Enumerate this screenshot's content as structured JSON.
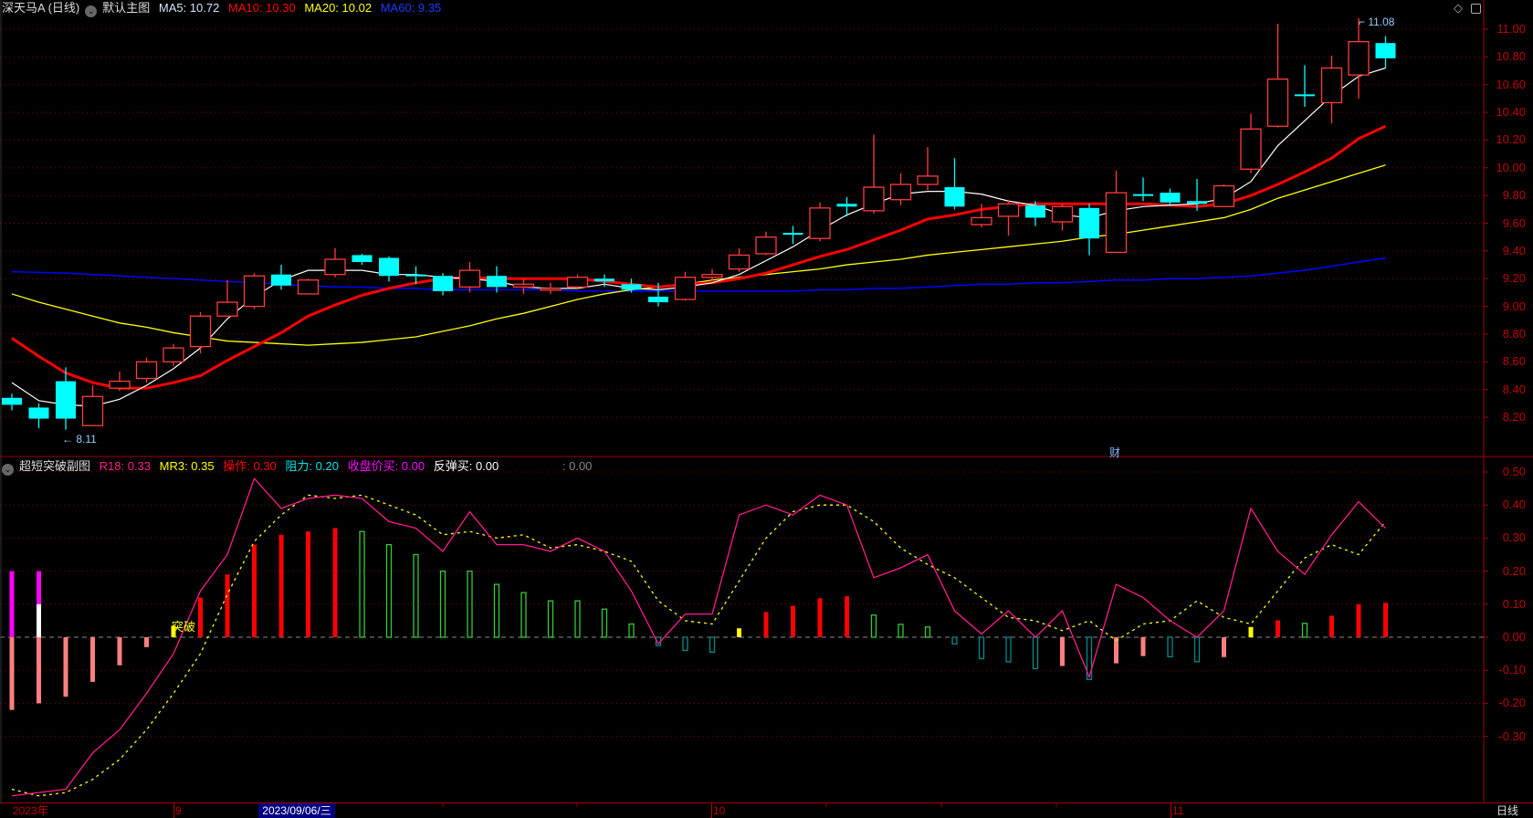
{
  "main_header": {
    "symbol": "深天马A (日线)",
    "template": "默认主图",
    "ma5": "MA5: 10.72",
    "ma10": "MA10: 10.30",
    "ma20": "MA20: 10.02",
    "ma60": "MA60: 9.35"
  },
  "sub_header": {
    "name": "超短突破副图",
    "r18": "R18: 0.33",
    "mr3": "MR3: 0.35",
    "op": "操作: 0.30",
    "res": "阻力: 0.20",
    "close_buy": "收盘价买: 0.00",
    "rebound_buy": "反弹买: 0.00",
    "blank": ": 0.00"
  },
  "colors": {
    "up": "#ff3b3b",
    "down": "#00ffff",
    "ma5": "#ffffff",
    "ma10": "#ff0000",
    "ma20": "#ffff00",
    "ma60": "#0000ff",
    "r18": "#ff1a8c",
    "mr3": "#ffff00",
    "axis": "#c00000"
  },
  "price_axis": [
    "11.00",
    "10.80",
    "10.60",
    "10.40",
    "10.20",
    "10.00",
    "9.80",
    "9.60",
    "9.40",
    "9.20",
    "9.00",
    "8.80",
    "8.60",
    "8.40",
    "8.20"
  ],
  "sub_axis": [
    "0.50",
    "0.40",
    "0.30",
    "0.20",
    "0.10",
    "0.00",
    "-0.10",
    "-0.20",
    "-0.30"
  ],
  "low_marker": "8.11",
  "high_marker": "11.08",
  "finance_marker": "财",
  "signal_label": "突破",
  "dates": {
    "year": "2023年",
    "m9": "9",
    "selected": "2023/09/06/三",
    "m10": "10",
    "m11": "11",
    "period": "日线"
  },
  "icons": {
    "diamond": "diamond-icon",
    "panel": "panel-toggle-icon",
    "collapse": "chevron-down-icon"
  },
  "ohlc": [
    [
      8.34,
      8.37,
      8.25,
      8.29
    ],
    [
      8.27,
      8.3,
      8.12,
      8.19
    ],
    [
      8.46,
      8.56,
      8.11,
      8.19
    ],
    [
      8.14,
      8.43,
      8.14,
      8.35
    ],
    [
      8.41,
      8.53,
      8.39,
      8.46
    ],
    [
      8.48,
      8.63,
      8.45,
      8.6
    ],
    [
      8.6,
      8.73,
      8.57,
      8.7
    ],
    [
      8.71,
      8.96,
      8.66,
      8.93
    ],
    [
      8.93,
      9.19,
      8.93,
      9.03
    ],
    [
      9.0,
      9.24,
      8.98,
      9.22
    ],
    [
      9.23,
      9.3,
      9.12,
      9.15
    ],
    [
      9.09,
      9.2,
      9.09,
      9.19
    ],
    [
      9.23,
      9.42,
      9.21,
      9.34
    ],
    [
      9.37,
      9.38,
      9.3,
      9.32
    ],
    [
      9.35,
      9.36,
      9.18,
      9.22
    ],
    [
      9.23,
      9.29,
      9.16,
      9.22
    ],
    [
      9.22,
      9.24,
      9.08,
      9.11
    ],
    [
      9.14,
      9.32,
      9.1,
      9.26
    ],
    [
      9.22,
      9.29,
      9.1,
      9.14
    ],
    [
      9.14,
      9.2,
      9.09,
      9.16
    ],
    [
      9.12,
      9.17,
      9.09,
      9.13
    ],
    [
      9.14,
      9.23,
      9.12,
      9.21
    ],
    [
      9.2,
      9.23,
      9.14,
      9.18
    ],
    [
      9.16,
      9.2,
      9.1,
      9.12
    ],
    [
      9.07,
      9.17,
      9.0,
      9.03
    ],
    [
      9.05,
      9.25,
      9.04,
      9.21
    ],
    [
      9.21,
      9.27,
      9.19,
      9.23
    ],
    [
      9.27,
      9.42,
      9.25,
      9.37
    ],
    [
      9.38,
      9.54,
      9.37,
      9.5
    ],
    [
      9.53,
      9.58,
      9.45,
      9.52
    ],
    [
      9.49,
      9.75,
      9.47,
      9.71
    ],
    [
      9.74,
      9.79,
      9.65,
      9.72
    ],
    [
      9.69,
      10.24,
      9.67,
      9.86
    ],
    [
      9.77,
      9.96,
      9.73,
      9.88
    ],
    [
      9.88,
      10.15,
      9.84,
      9.94
    ],
    [
      9.86,
      10.07,
      9.7,
      9.72
    ],
    [
      9.59,
      9.74,
      9.57,
      9.64
    ],
    [
      9.65,
      9.77,
      9.51,
      9.74
    ],
    [
      9.73,
      9.76,
      9.58,
      9.64
    ],
    [
      9.61,
      9.74,
      9.55,
      9.72
    ],
    [
      9.71,
      9.74,
      9.37,
      9.49
    ],
    [
      9.39,
      9.98,
      9.39,
      9.82
    ],
    [
      9.81,
      9.93,
      9.76,
      9.8
    ],
    [
      9.82,
      9.85,
      9.73,
      9.75
    ],
    [
      9.76,
      9.92,
      9.69,
      9.74
    ],
    [
      9.72,
      9.88,
      9.72,
      9.87
    ],
    [
      9.99,
      10.39,
      9.96,
      10.28
    ],
    [
      10.3,
      11.04,
      10.29,
      10.64
    ],
    [
      10.53,
      10.74,
      10.44,
      10.52
    ],
    [
      10.47,
      10.81,
      10.32,
      10.72
    ],
    [
      10.67,
      11.08,
      10.5,
      10.91
    ],
    [
      10.9,
      10.95,
      10.72,
      10.79
    ]
  ],
  "ma5": [
    8.45,
    8.32,
    8.29,
    8.28,
    8.33,
    8.43,
    8.55,
    8.7,
    8.91,
    9.07,
    9.19,
    9.26,
    9.26,
    9.26,
    9.23,
    9.23,
    9.21,
    9.2,
    9.18,
    9.14,
    9.13,
    9.13,
    9.16,
    9.13,
    9.12,
    9.14,
    9.17,
    9.23,
    9.33,
    9.43,
    9.55,
    9.66,
    9.74,
    9.81,
    9.83,
    9.83,
    9.81,
    9.76,
    9.73,
    9.66,
    9.64,
    9.69,
    9.72,
    9.73,
    9.74,
    9.78,
    9.9,
    10.16,
    10.34,
    10.52,
    10.66,
    10.72
  ],
  "ma10": [
    8.77,
    8.64,
    8.52,
    8.45,
    8.41,
    8.41,
    8.45,
    8.5,
    8.61,
    8.71,
    8.81,
    8.93,
    9.01,
    9.08,
    9.13,
    9.17,
    9.2,
    9.21,
    9.2,
    9.2,
    9.2,
    9.2,
    9.18,
    9.16,
    9.14,
    9.16,
    9.17,
    9.2,
    9.24,
    9.3,
    9.36,
    9.41,
    9.48,
    9.55,
    9.63,
    9.66,
    9.7,
    9.72,
    9.74,
    9.74,
    9.74,
    9.74,
    9.74,
    9.73,
    9.72,
    9.74,
    9.8,
    9.88,
    9.97,
    10.07,
    10.21,
    10.3
  ],
  "ma20": [
    9.09,
    9.03,
    8.98,
    8.93,
    8.88,
    8.85,
    8.81,
    8.78,
    8.75,
    8.74,
    8.73,
    8.72,
    8.73,
    8.74,
    8.76,
    8.78,
    8.82,
    8.86,
    8.91,
    8.95,
    9.0,
    9.05,
    9.09,
    9.12,
    9.14,
    9.16,
    9.19,
    9.21,
    9.23,
    9.25,
    9.27,
    9.3,
    9.32,
    9.34,
    9.37,
    9.39,
    9.41,
    9.43,
    9.45,
    9.47,
    9.5,
    9.52,
    9.55,
    9.58,
    9.61,
    9.64,
    9.7,
    9.78,
    9.84,
    9.9,
    9.96,
    10.02
  ],
  "ma60": [
    9.25,
    9.245,
    9.24,
    9.23,
    9.22,
    9.21,
    9.2,
    9.19,
    9.18,
    9.17,
    9.16,
    9.15,
    9.14,
    9.14,
    9.13,
    9.13,
    9.12,
    9.12,
    9.12,
    9.12,
    9.12,
    9.11,
    9.11,
    9.11,
    9.11,
    9.11,
    9.11,
    9.11,
    9.11,
    9.11,
    9.12,
    9.12,
    9.13,
    9.13,
    9.14,
    9.15,
    9.16,
    9.16,
    9.17,
    9.17,
    9.18,
    9.19,
    9.19,
    9.2,
    9.2,
    9.21,
    9.22,
    9.24,
    9.26,
    9.29,
    9.32,
    9.35
  ],
  "r18": [
    -0.48,
    -0.47,
    -0.46,
    -0.35,
    -0.28,
    -0.17,
    -0.05,
    0.14,
    0.25,
    0.48,
    0.39,
    0.42,
    0.43,
    0.42,
    0.35,
    0.33,
    0.26,
    0.38,
    0.28,
    0.28,
    0.26,
    0.3,
    0.26,
    0.14,
    -0.02,
    0.07,
    0.07,
    0.37,
    0.4,
    0.37,
    0.43,
    0.4,
    0.18,
    0.21,
    0.25,
    0.08,
    0.01,
    0.08,
    0.0,
    0.08,
    -0.12,
    0.16,
    0.12,
    0.05,
    0.0,
    0.08,
    0.39,
    0.26,
    0.19,
    0.31,
    0.41,
    0.33
  ],
  "mr3": [
    -0.46,
    -0.48,
    -0.47,
    -0.43,
    -0.37,
    -0.28,
    -0.17,
    -0.05,
    0.13,
    0.29,
    0.37,
    0.43,
    0.42,
    0.43,
    0.4,
    0.37,
    0.31,
    0.32,
    0.3,
    0.31,
    0.27,
    0.28,
    0.26,
    0.23,
    0.11,
    0.05,
    0.04,
    0.17,
    0.3,
    0.38,
    0.4,
    0.4,
    0.35,
    0.27,
    0.22,
    0.18,
    0.12,
    0.06,
    0.05,
    0.02,
    0.05,
    -0.01,
    0.04,
    0.05,
    0.11,
    0.06,
    0.04,
    0.14,
    0.24,
    0.28,
    0.25,
    0.35
  ],
  "bars": [
    [
      -0.22,
      "down"
    ],
    [
      -0.2,
      "down"
    ],
    [
      -0.18,
      "down"
    ],
    [
      -0.135,
      "down"
    ],
    [
      -0.085,
      "down"
    ],
    [
      -0.03,
      "down"
    ],
    [
      0.035,
      "signal"
    ],
    [
      0.12,
      "buy"
    ],
    [
      0.19,
      "buy"
    ],
    [
      0.28,
      "buy"
    ],
    [
      0.31,
      "buy"
    ],
    [
      0.32,
      "buy"
    ],
    [
      0.33,
      "buy"
    ],
    [
      0.32,
      "hold"
    ],
    [
      0.28,
      "hold"
    ],
    [
      0.25,
      "hold"
    ],
    [
      0.2,
      "hold"
    ],
    [
      0.2,
      "hold"
    ],
    [
      0.16,
      "hold"
    ],
    [
      0.135,
      "hold"
    ],
    [
      0.11,
      "hold"
    ],
    [
      0.11,
      "hold"
    ],
    [
      0.085,
      "hold"
    ],
    [
      0.04,
      "hold"
    ],
    [
      -0.025,
      "sell"
    ],
    [
      -0.04,
      "sell"
    ],
    [
      -0.045,
      "sell"
    ],
    [
      0.027,
      "signal"
    ],
    [
      0.076,
      "buy"
    ],
    [
      0.095,
      "buy"
    ],
    [
      0.118,
      "buy"
    ],
    [
      0.124,
      "buy"
    ],
    [
      0.067,
      "hold"
    ],
    [
      0.039,
      "hold"
    ],
    [
      0.031,
      "hold"
    ],
    [
      -0.02,
      "sell"
    ],
    [
      -0.065,
      "sell"
    ],
    [
      -0.074,
      "sell"
    ],
    [
      -0.095,
      "sell"
    ],
    [
      -0.087,
      "down"
    ],
    [
      -0.128,
      "sell"
    ],
    [
      -0.079,
      "down"
    ],
    [
      -0.057,
      "down"
    ],
    [
      -0.059,
      "sell"
    ],
    [
      -0.074,
      "sell"
    ],
    [
      -0.06,
      "down"
    ],
    [
      0.031,
      "signal"
    ],
    [
      0.051,
      "buy"
    ],
    [
      0.042,
      "hold"
    ],
    [
      0.065,
      "buy"
    ],
    [
      0.1,
      "buy"
    ],
    [
      0.104,
      "buy"
    ]
  ],
  "extra_bars": [
    [
      0,
      0.2,
      0,
      "#ff00ff"
    ],
    [
      1,
      0.2,
      0.1,
      "#ff00ff"
    ],
    [
      1,
      0.1,
      0,
      "#ffffff"
    ]
  ]
}
